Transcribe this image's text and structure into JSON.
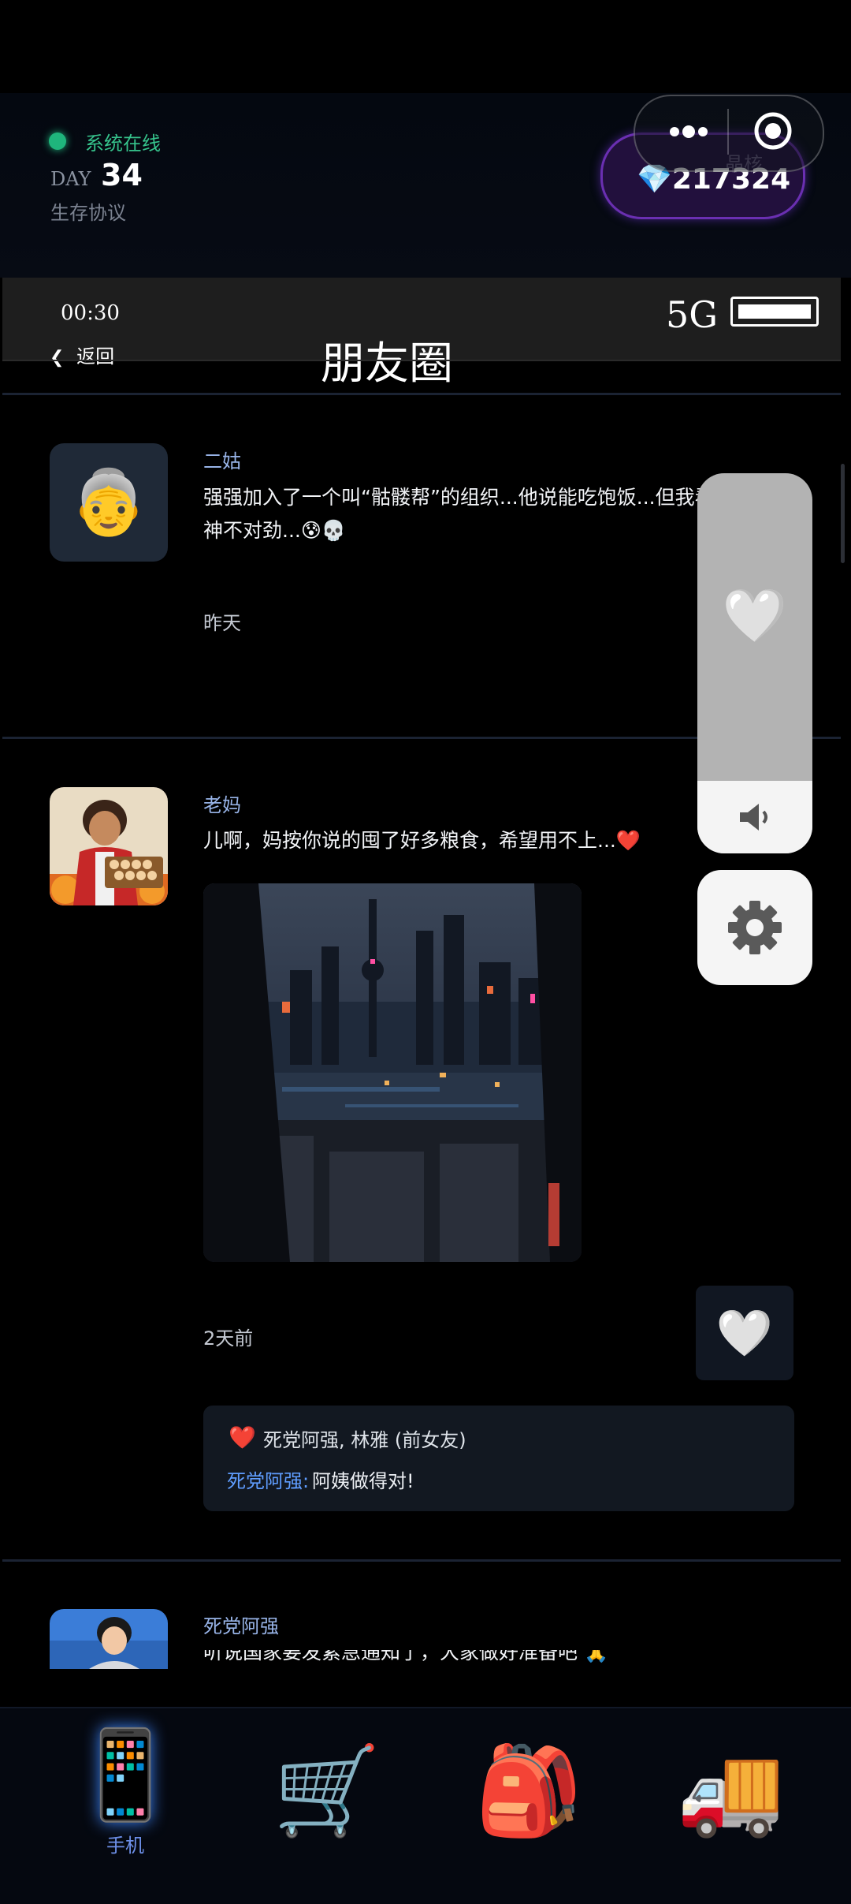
{
  "header": {
    "status_text": "系统在线",
    "day_label": "DAY",
    "day_number": "34",
    "protocol_text": "生存协议",
    "gem_label": "晶核",
    "gem_value": "💎217324"
  },
  "phone": {
    "time": "00:30",
    "signal": "5G",
    "back_label": "返回",
    "back_icon": "chevron-left-icon",
    "title": "朋友圈"
  },
  "posts": [
    {
      "name": "二姑",
      "avatar_emoji": "👵",
      "text_line1": "强强加入了一个叫“骷髅帮”的组织...他说能吃饱饭...但我看那些人眼",
      "text_line2": "神不对劲...😰💀",
      "time": "昨天"
    },
    {
      "name": "老妈",
      "text": "儿啊，妈按你说的囤了好多粮食，希望用不上...❤️",
      "time": "2天前",
      "like_icon": "🤍",
      "likes": "死党阿强, 林雅 (前女友)",
      "likes_icon": "❤️",
      "comment_author": "死党阿强:",
      "comment_text": "阿姨做得对!"
    },
    {
      "name": "死党阿强",
      "text": "听说国家要发紧急通知了，大家做好准备吧 🙏"
    }
  ],
  "float_panel": {
    "heart_icon": "🤍",
    "speaker_icon": "speaker-icon",
    "settings_icon": "gear-icon"
  },
  "nav": {
    "items": [
      {
        "label": "手机",
        "icon": "📱",
        "active": true
      },
      {
        "label": "",
        "icon": "🛒",
        "active": false
      },
      {
        "label": "",
        "icon": "🎒",
        "active": false
      },
      {
        "label": "",
        "icon": "🚚",
        "active": false
      }
    ]
  },
  "colors": {
    "accent_online": "#1fb57c",
    "gem_border": "#6a2fb1",
    "name_blue": "#98b4e8",
    "comment_blue": "#5f9dff",
    "heart_red": "#f0344b"
  }
}
